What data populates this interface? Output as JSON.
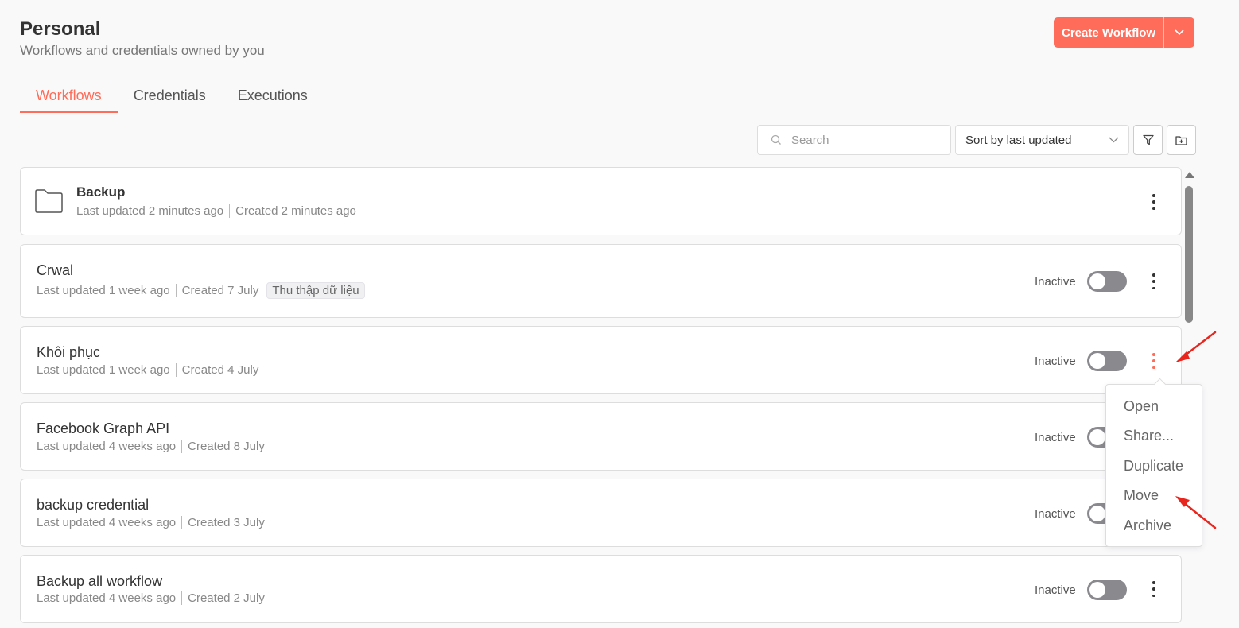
{
  "header": {
    "title": "Personal",
    "subtitle": "Workflows and credentials owned by you"
  },
  "actions": {
    "create_label": "Create Workflow",
    "accent": "#ff6d5a"
  },
  "tabs": [
    {
      "label": "Workflows",
      "active": true
    },
    {
      "label": "Credentials",
      "active": false
    },
    {
      "label": "Executions",
      "active": false
    }
  ],
  "toolbar": {
    "search_placeholder": "Search",
    "sort_label": "Sort by last updated"
  },
  "items": [
    {
      "type": "folder",
      "title": "Backup",
      "updated": "Last updated 2 minutes ago",
      "created": "Created 2 minutes ago"
    },
    {
      "type": "workflow",
      "title": "Crwal",
      "updated": "Last updated 1 week ago",
      "created": "Created 7 July",
      "tag": "Thu thập dữ liệu",
      "status": "Inactive"
    },
    {
      "type": "workflow",
      "title": "Khôi phục",
      "updated": "Last updated 1 week ago",
      "created": "Created 4 July",
      "status": "Inactive"
    },
    {
      "type": "workflow",
      "title": "Facebook Graph API",
      "updated": "Last updated 4 weeks ago",
      "created": "Created 8 July",
      "status": "Inactive"
    },
    {
      "type": "workflow",
      "title": "backup credential",
      "updated": "Last updated 4 weeks ago",
      "created": "Created 3 July",
      "status": "Inactive"
    },
    {
      "type": "workflow",
      "title": "Backup all workflow",
      "updated": "Last updated 4 weeks ago",
      "created": "Created 2 July",
      "status": "Inactive"
    }
  ],
  "context_menu": {
    "items": [
      "Open",
      "Share...",
      "Duplicate",
      "Move",
      "Archive"
    ]
  }
}
